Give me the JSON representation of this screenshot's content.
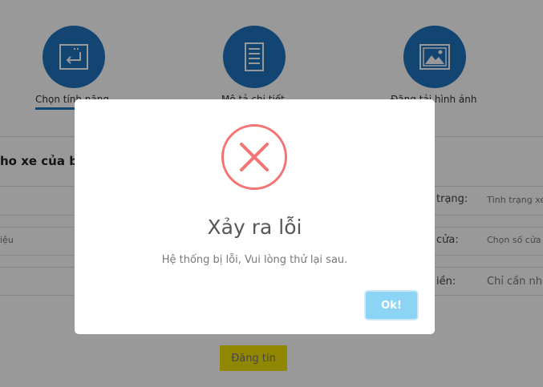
{
  "steps": [
    {
      "label": "Chọn tính năng",
      "icon": "return-key-icon"
    },
    {
      "label": "Mô tả chi tiết",
      "icon": "document-icon"
    },
    {
      "label": "Đăng tải hình ảnh",
      "icon": "image-icon"
    }
  ],
  "form": {
    "section_title": "ho xe của bạn",
    "left_field_value": "iệu",
    "right_fields": [
      {
        "label": "trạng:",
        "value": "Tình trạng xe"
      },
      {
        "label": "cửa:",
        "value": "Chọn số cửa"
      },
      {
        "label": "iền:",
        "value": "Chỉ cần nhập"
      }
    ],
    "submit_label": "Đăng tin"
  },
  "modal": {
    "icon": "error-x-icon",
    "title": "Xảy ra lỗi",
    "message": "Hệ thống bị lỗi, Vui lòng thử lại sau.",
    "ok_label": "Ok!"
  },
  "colors": {
    "step_blue": "#1e73be",
    "error_red": "#f27474",
    "ok_button": "#8cd4f5",
    "submit_button": "#f0e000"
  }
}
